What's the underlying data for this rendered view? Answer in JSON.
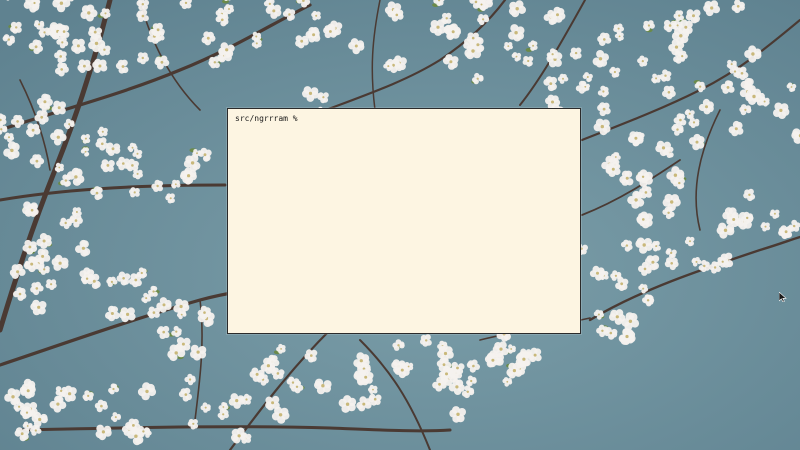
{
  "desktop": {
    "background_color": "#6e8f9c",
    "blossom_color": "#f4f1ee",
    "branch_color": "#4a3a33",
    "leaf_color": "#6b8a4a"
  },
  "terminal": {
    "prompt": "src/ngrrram %",
    "background_color": "#fdf5e2",
    "text_color": "#1a1a1a"
  },
  "cursor": {
    "icon": "mouse-pointer-icon",
    "color": "#1a1a1a"
  }
}
